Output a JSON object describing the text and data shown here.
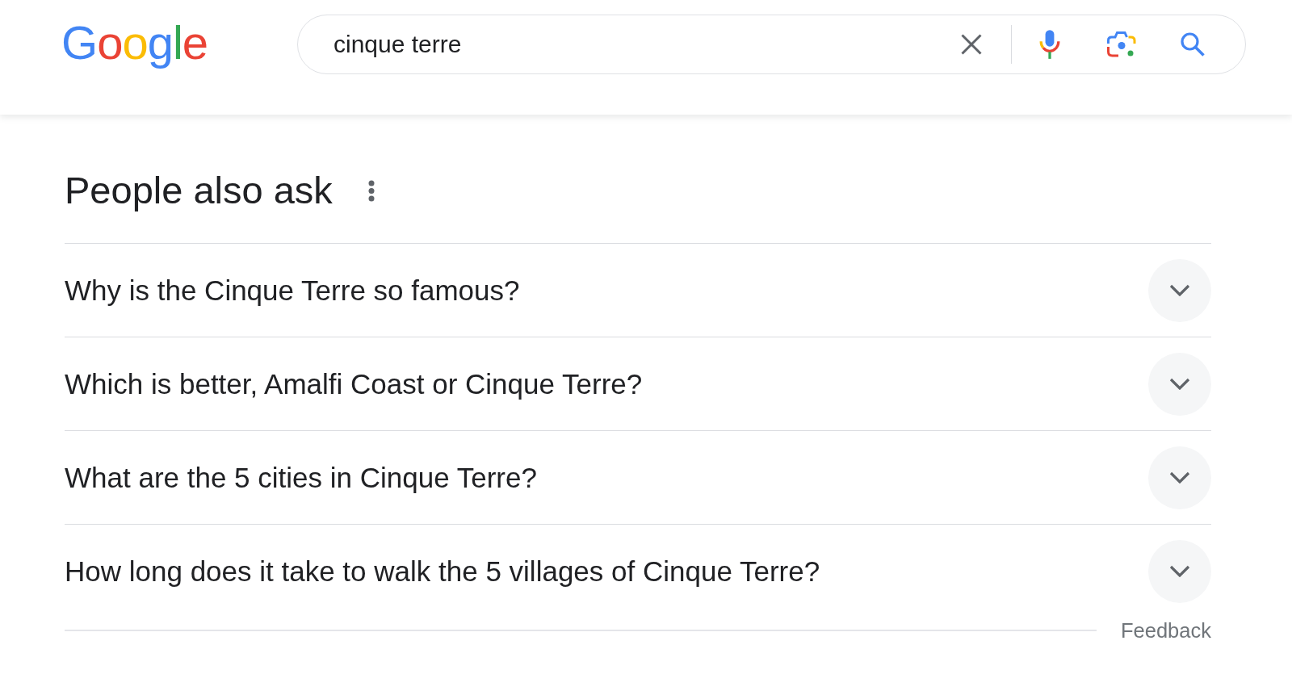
{
  "header": {
    "logo": "Google",
    "search": {
      "value": "cinque terre"
    }
  },
  "people_also_ask": {
    "title": "People also ask",
    "questions": [
      {
        "text": "Why is the Cinque Terre so famous?",
        "expanded": false
      },
      {
        "text": "Which is better, Amalfi Coast or Cinque Terre?",
        "expanded": false
      },
      {
        "text": "What are the 5 cities in Cinque Terre?",
        "expanded": false
      },
      {
        "text": "How long does it take to walk the 5 villages of Cinque Terre?",
        "expanded": false
      }
    ],
    "feedback": "Feedback"
  }
}
